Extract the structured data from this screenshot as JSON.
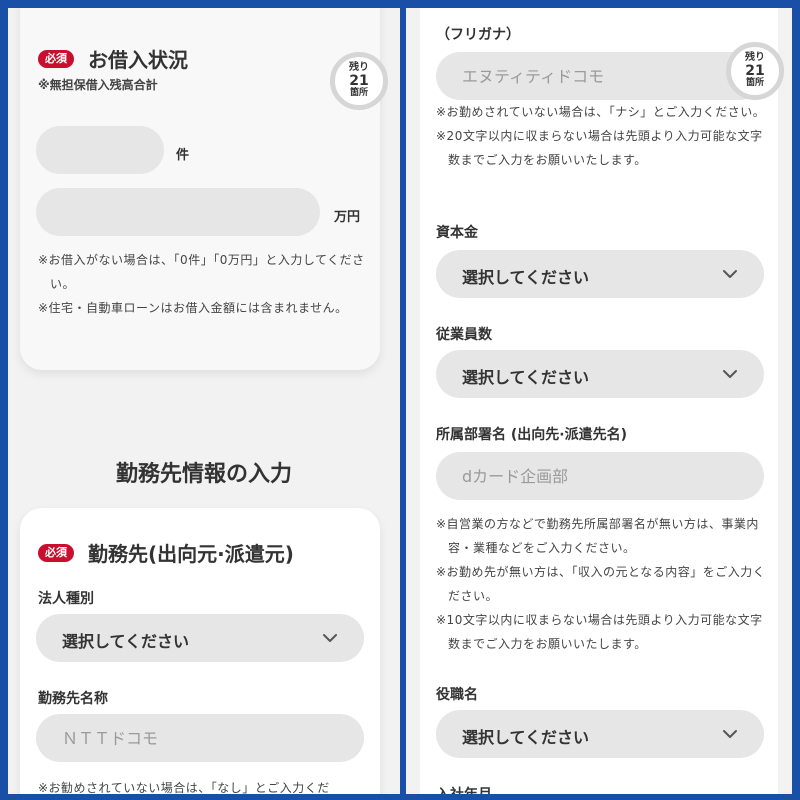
{
  "left": {
    "borrowing": {
      "badge": "必須",
      "title": "お借入状況",
      "subtitle": "※無担保借入残高合計",
      "counter": {
        "top": "残り",
        "num": "21",
        "bottom": "箇所"
      },
      "unit_count": "件",
      "unit_amount": "万円",
      "notes": [
        "※お借入がない場合は、「0件」「0万円」と入力してください。",
        "※住宅・自動車ローンはお借入金額には含まれません。"
      ]
    },
    "section_title": "勤務先情報の入力",
    "employer": {
      "badge": "必須",
      "title": "勤務先(出向元·派遣元)",
      "corp_type_label": "法人種別",
      "corp_type_value": "選択してください",
      "name_label": "勤務先名称",
      "name_placeholder": "ＮＴＴドコモ",
      "note": "※お勧めされていない場合は、「なし」とご入力くだ"
    }
  },
  "right": {
    "furigana_label": "（フリガナ）",
    "furigana_placeholder": "エヌティティドコモ",
    "counter": {
      "top": "残り",
      "num": "21",
      "bottom": "箇所"
    },
    "furigana_notes": [
      "※お勤めされていない場合は、「ナシ」とご入力ください。",
      "※20文字以内に収まらない場合は先頭より入力可能な文字数までご入力をお願いいたします。"
    ],
    "capital_label": "資本金",
    "capital_value": "選択してください",
    "employees_label": "従業員数",
    "employees_value": "選択してください",
    "dept_label": "所属部署名 (出向先·派遣先名)",
    "dept_placeholder": "dカード企画部",
    "dept_notes": [
      "※自営業の方などで勤務先所属部署名が無い方は、事業内容・業種などをご入力ください。",
      "※お勤め先が無い方は、「収入の元となる内容」をご入力ください。",
      "※10文字以内に収まらない場合は先頭より入力可能な文字数までご入力をお願いいたします。"
    ],
    "position_label": "役職名",
    "position_value": "選択してください",
    "join_label": "入社年月"
  }
}
